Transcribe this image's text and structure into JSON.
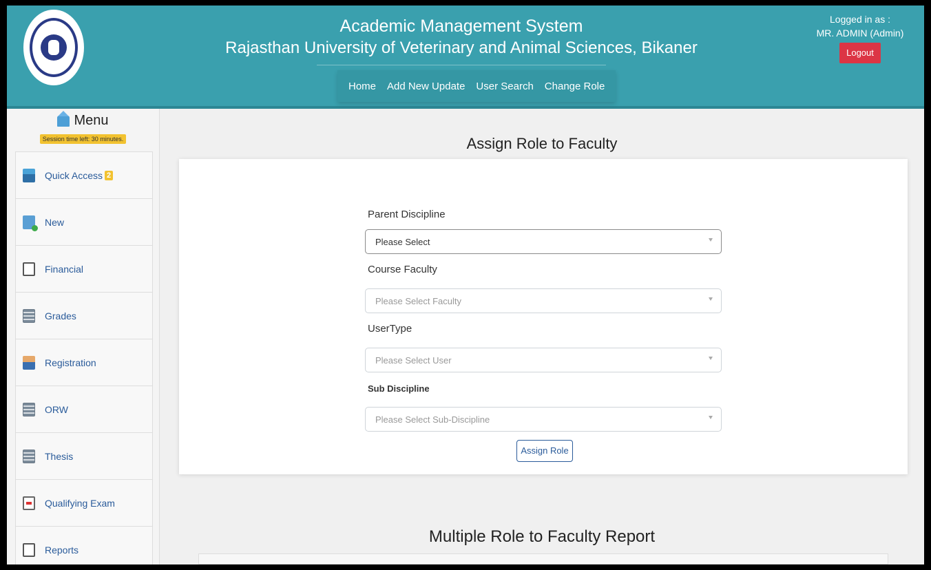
{
  "header": {
    "title_line1": "Academic Management System",
    "title_line2": "Rajasthan University of Veterinary and Animal Sciences, Bikaner",
    "nav": [
      "Home",
      "Add New Update",
      "User Search",
      "Change Role"
    ],
    "logged_in_label": "Logged in as :",
    "user": "MR. ADMIN (Admin)",
    "logout_label": "Logout",
    "header_color": "#3aa0ae",
    "logout_color": "#dc3545"
  },
  "sidebar": {
    "menu_title": "Menu",
    "session_text": "Session time left: 30 minutes.",
    "items": [
      {
        "label": "Quick Access",
        "badge": "2",
        "icon": "inbox-icon"
      },
      {
        "label": "New",
        "icon": "new-document-icon"
      },
      {
        "label": "Financial",
        "icon": "money-bag-icon"
      },
      {
        "label": "Grades",
        "icon": "grid-document-icon"
      },
      {
        "label": "Registration",
        "icon": "user-icon"
      },
      {
        "label": "ORW",
        "icon": "grid-document-icon"
      },
      {
        "label": "Thesis",
        "icon": "grid-document-icon"
      },
      {
        "label": "Qualifying Exam",
        "icon": "pdf-document-icon"
      },
      {
        "label": "Reports",
        "icon": "report-document-icon"
      }
    ]
  },
  "main": {
    "heading": "Assign Role to Faculty",
    "fields": {
      "parent_discipline": {
        "label": "Parent Discipline",
        "value": "Please Select"
      },
      "course_faculty": {
        "label": "Course Faculty",
        "value": "Please Select Faculty"
      },
      "user_type": {
        "label": "UserType",
        "value": "Please Select User"
      },
      "sub_discipline": {
        "label": "Sub Discipline",
        "value": "Please Select Sub-Discipline"
      }
    },
    "assign_button": "Assign Role",
    "report_heading": "Multiple Role to Faculty Report"
  }
}
